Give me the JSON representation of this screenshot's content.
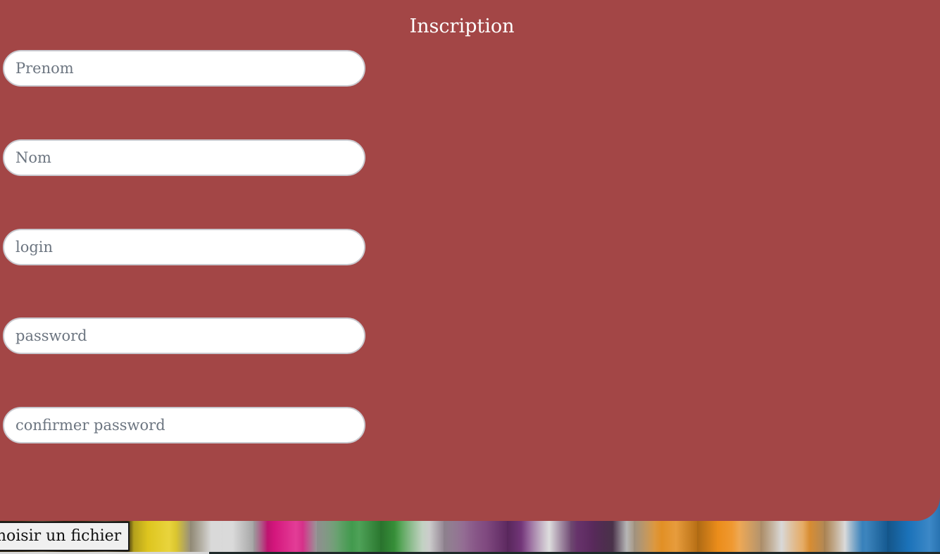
{
  "form": {
    "title": "Inscription",
    "fields": [
      {
        "placeholder": "Prenom",
        "value": ""
      },
      {
        "placeholder": "Nom",
        "value": ""
      },
      {
        "placeholder": "login",
        "value": ""
      },
      {
        "placeholder": "password",
        "value": ""
      },
      {
        "placeholder": "confirmer password",
        "value": ""
      }
    ],
    "file_button_label": "Choisir un fichier"
  },
  "colors": {
    "panel": "#a34646",
    "title": "#ffffff",
    "input_background": "#ffffff",
    "input_border": "#c9c9cf"
  }
}
